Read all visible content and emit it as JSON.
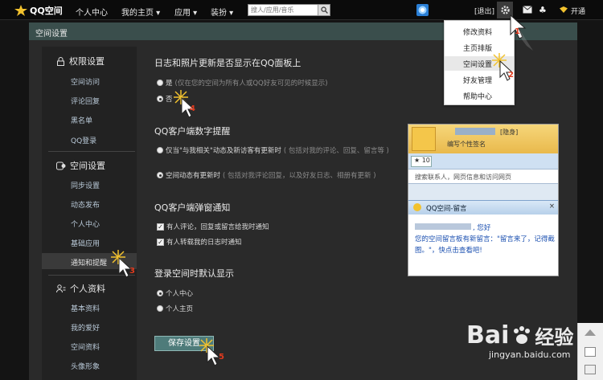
{
  "topbar": {
    "logo_text": "QQ空间",
    "nav": [
      "个人中心",
      "我的主页 ▾",
      "应用 ▾",
      "装扮 ▾"
    ],
    "search_placeholder": "搜人/应用/音乐",
    "logout": "[退出]",
    "user_level": "开通"
  },
  "panel_title": "空间设置",
  "sidebar": {
    "sections": [
      {
        "title": "权限设置",
        "items": [
          "空间访问",
          "评论回复",
          "黑名单",
          "QQ登录"
        ]
      },
      {
        "title": "空间设置",
        "items": [
          "同步设置",
          "动态发布",
          "个人中心",
          "基础应用",
          "通知和提醒"
        ]
      },
      {
        "title": "个人资料",
        "items": [
          "基本资料",
          "我的爱好",
          "空间资料",
          "头像形象"
        ]
      }
    ]
  },
  "main": {
    "q1": {
      "title": "日志和照片更新是否显示在QQ面板上",
      "opt_yes": "是",
      "opt_yes_hint": "(仅在您的空间为所有人或QQ好友可见的时候显示)",
      "opt_no": "否"
    },
    "q2": {
      "title": "QQ客户端数字提醒",
      "opt1": "仅当\"与我相关\"动态及新访客有更新时",
      "opt1_hint": "( 包括对我的评论、回复、留言等 )",
      "opt2": "空间动态有更新时",
      "opt2_hint": "( 包括对我评论回复，以及好友日志、相册有更新 )"
    },
    "q3": {
      "title": "QQ客户端弹窗通知",
      "chk1": "有人评论，回复或留言给我时通知",
      "chk2": "有人转载我的日志时通知"
    },
    "q4": {
      "title": "登录空间时默认显示",
      "opt1": "个人中心",
      "opt2": "个人主页"
    },
    "save": "保存设置"
  },
  "preview": {
    "status": "[隐身]",
    "signature": "编写个性签名",
    "count": "10",
    "search_placeholder": "搜索联系人，网页信息和访问网页",
    "popup_title": "QQ空间-留言",
    "popup_greeting": ", 您好",
    "popup_body": "您的空间留言板有新留言：\"留言来了，记得截图。\"，快点击查看吧!"
  },
  "dropdown": {
    "items": [
      "修改资料",
      "主页排版",
      "空间设置",
      "好友管理",
      "帮助中心"
    ]
  },
  "markers": [
    "2",
    "3",
    "4",
    "5"
  ],
  "watermark": {
    "brand": "Bai",
    "brand2": "经验",
    "url": "jingyan.baidu.com"
  },
  "colors": {
    "header": "#3a4e4c",
    "button": "#4e7b7a",
    "link": "#b9c9d8",
    "marker": "#e23b1e"
  }
}
